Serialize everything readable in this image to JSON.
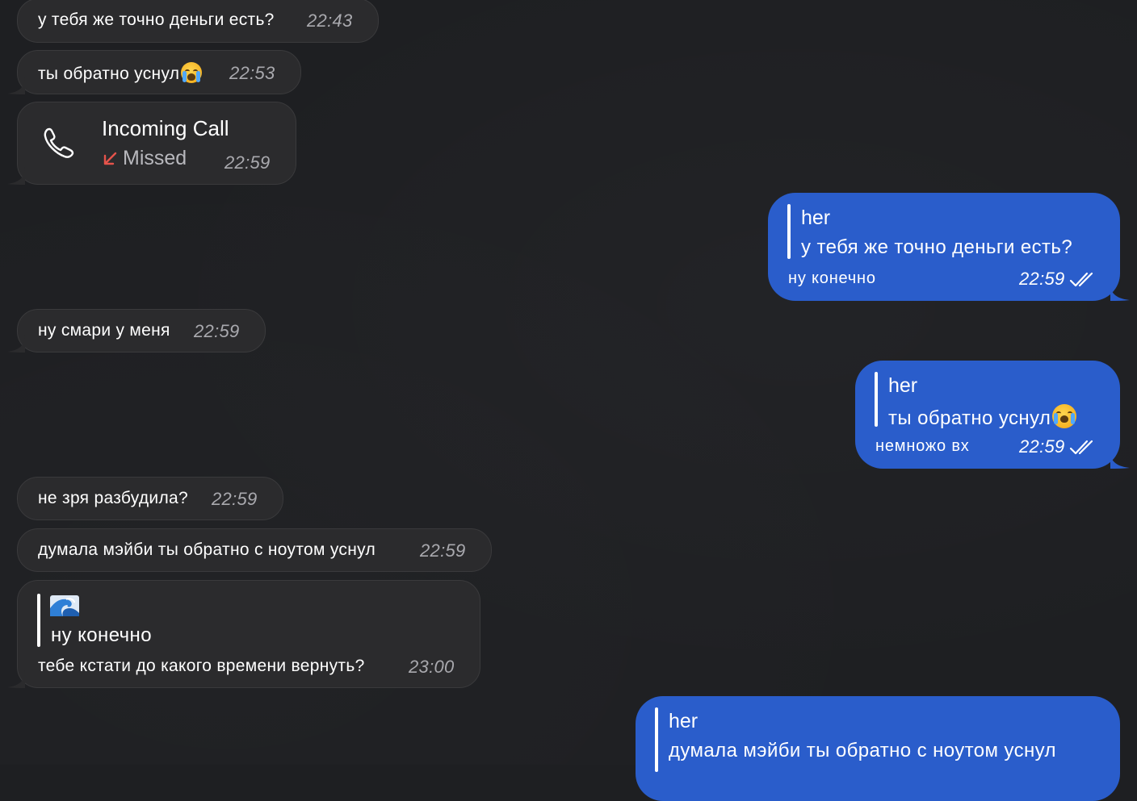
{
  "chat": {
    "messages": [
      {
        "direction": "in",
        "text": "у тебя же точно деньги есть?",
        "time": "22:43"
      },
      {
        "direction": "in",
        "text": "ты обратно уснул",
        "emoji": "loudly-crying-face",
        "time": "22:53"
      },
      {
        "direction": "in",
        "type": "call",
        "call_title": "Incoming Call",
        "call_status": "Missed",
        "time": "22:59"
      },
      {
        "direction": "out",
        "reply_author": "her",
        "reply_text": "у тебя же точно деньги есть?",
        "text": "ну конечно",
        "time": "22:59",
        "status": "read"
      },
      {
        "direction": "in",
        "text": "ну смари у меня",
        "time": "22:59"
      },
      {
        "direction": "out",
        "reply_author": "her",
        "reply_text": "ты обратно уснул",
        "reply_emoji": "loudly-crying-face",
        "text": "немножо вх",
        "time": "22:59",
        "status": "read"
      },
      {
        "direction": "in",
        "text": "не зря разбудила?",
        "time": "22:59"
      },
      {
        "direction": "in",
        "text": "думала мэйби ты обратно с ноутом уснул",
        "time": "22:59"
      },
      {
        "direction": "in",
        "reply_emoji": "water-wave",
        "reply_text": "ну конечно",
        "text": "тебе кстати до какого времени вернуть?",
        "time": "23:00"
      },
      {
        "direction": "out",
        "reply_author": "her",
        "reply_text": "думала мэйби ты обратно с ноутом уснул"
      }
    ]
  },
  "icons": {
    "call": "phone-icon",
    "missed": "missed-call-arrow-icon",
    "read": "double-check-icon"
  },
  "colors": {
    "background": "#1e1f22",
    "incoming_bubble": "#2b2b2d",
    "incoming_border": "#3a3a3c",
    "outgoing_bubble": "#2a5dcb",
    "missed_red": "#e5534b",
    "time_gray": "#a9a9ae"
  }
}
